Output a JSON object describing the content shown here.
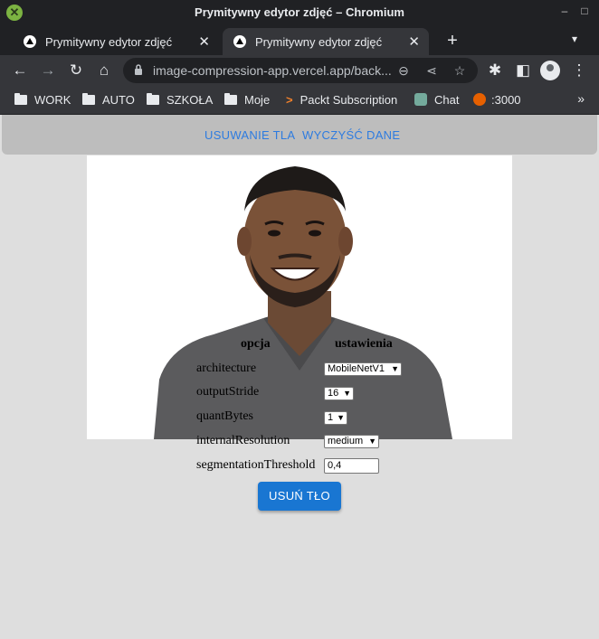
{
  "window": {
    "title": "Prymitywny edytor zdjęć – Chromium"
  },
  "tabs": [
    {
      "label": "Prymitywny edytor zdjęć"
    },
    {
      "label": "Prymitywny edytor zdjęć"
    }
  ],
  "address_bar": {
    "url": "image-compression-app.vercel.app/back..."
  },
  "bookmarks": [
    {
      "label": "WORK",
      "icon": "folder-icon"
    },
    {
      "label": "AUTO",
      "icon": "folder-icon"
    },
    {
      "label": "SZKOŁA",
      "icon": "folder-icon"
    },
    {
      "label": "Moje",
      "icon": "folder-icon"
    },
    {
      "label": "Packt Subscription",
      "icon": "packt-icon"
    },
    {
      "label": "Chat",
      "icon": "chatgpt-icon"
    },
    {
      "label": ":3000",
      "icon": "firefox-icon"
    }
  ],
  "nav": {
    "remove_bg": "USUWANIE TLA",
    "clear_data": "WYCZYŚĆ DANE",
    "link_color": "#2d7be0"
  },
  "image": {
    "subject": "smiling man in grey v-neck t-shirt"
  },
  "options_table": {
    "header_option": "opcja",
    "header_settings": "ustawienia",
    "rows": [
      {
        "label": "architecture",
        "value": "MobileNetV1",
        "kind": "select"
      },
      {
        "label": "outputStride",
        "value": "16",
        "kind": "select"
      },
      {
        "label": "quantBytes",
        "value": "1",
        "kind": "select"
      },
      {
        "label": "internalResolution",
        "value": "medium",
        "kind": "select"
      },
      {
        "label": "segmentationThreshold",
        "value": "0,4",
        "kind": "text"
      }
    ]
  },
  "submit": {
    "label": "USUŃ TŁO",
    "color": "#1976d2"
  }
}
